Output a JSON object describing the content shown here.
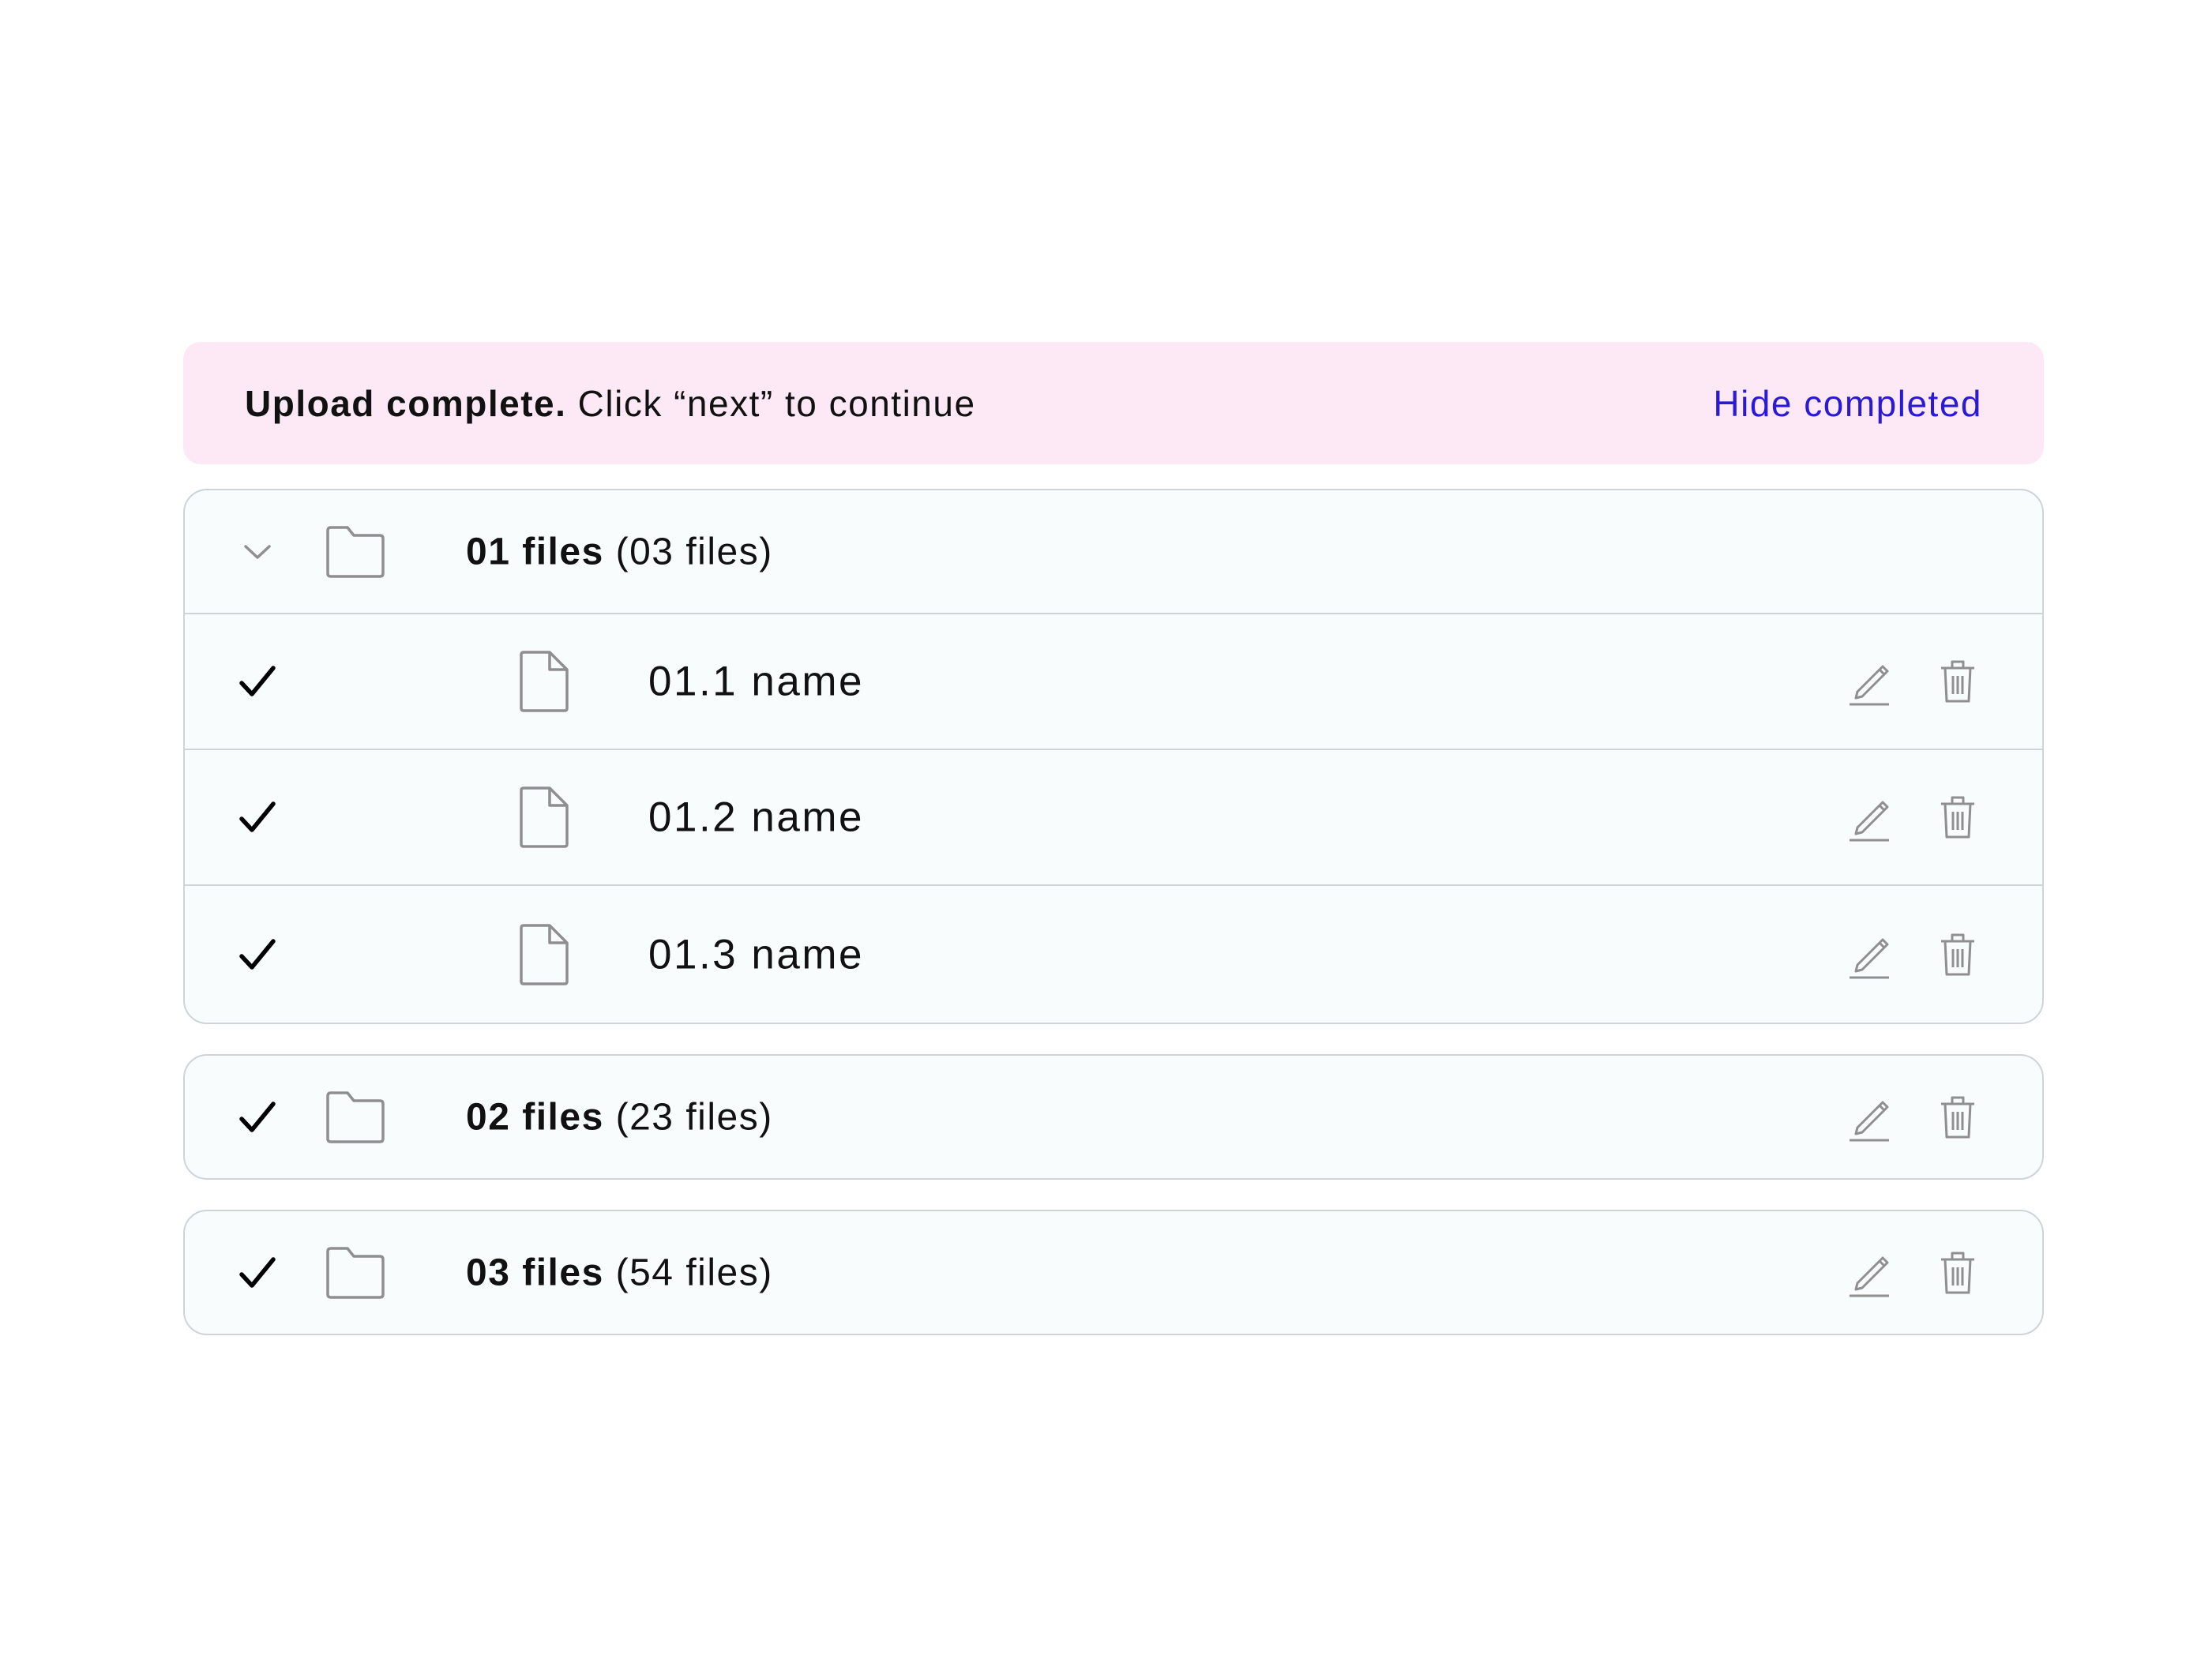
{
  "banner": {
    "bold": "Upload complete.",
    "message": "Click “next” to continue",
    "action": "Hide completed"
  },
  "groups": [
    {
      "name": "01 files",
      "count": "(03 files)",
      "state": "expanded",
      "files": [
        {
          "name": "01.1 name",
          "status": "complete"
        },
        {
          "name": "01.2 name",
          "status": "complete"
        },
        {
          "name": "01.3 name",
          "status": "complete"
        }
      ]
    },
    {
      "name": "02 files",
      "count": "(23 files)",
      "state": "collapsed",
      "status": "complete"
    },
    {
      "name": "03 files",
      "count": "(54 files)",
      "state": "collapsed",
      "status": "complete"
    }
  ],
  "icons": {
    "expand": "chevron-down-icon",
    "folder": "folder-icon",
    "file": "file-icon",
    "done": "checkmark-icon",
    "edit": "pencil-icon",
    "delete": "trash-icon"
  },
  "colors": {
    "banner_bg": "#fde8f5",
    "link": "#2a1ad8",
    "row_bg": "#f9fcfd",
    "border": "#cfd4d8",
    "icon": "#8f8f8f"
  }
}
